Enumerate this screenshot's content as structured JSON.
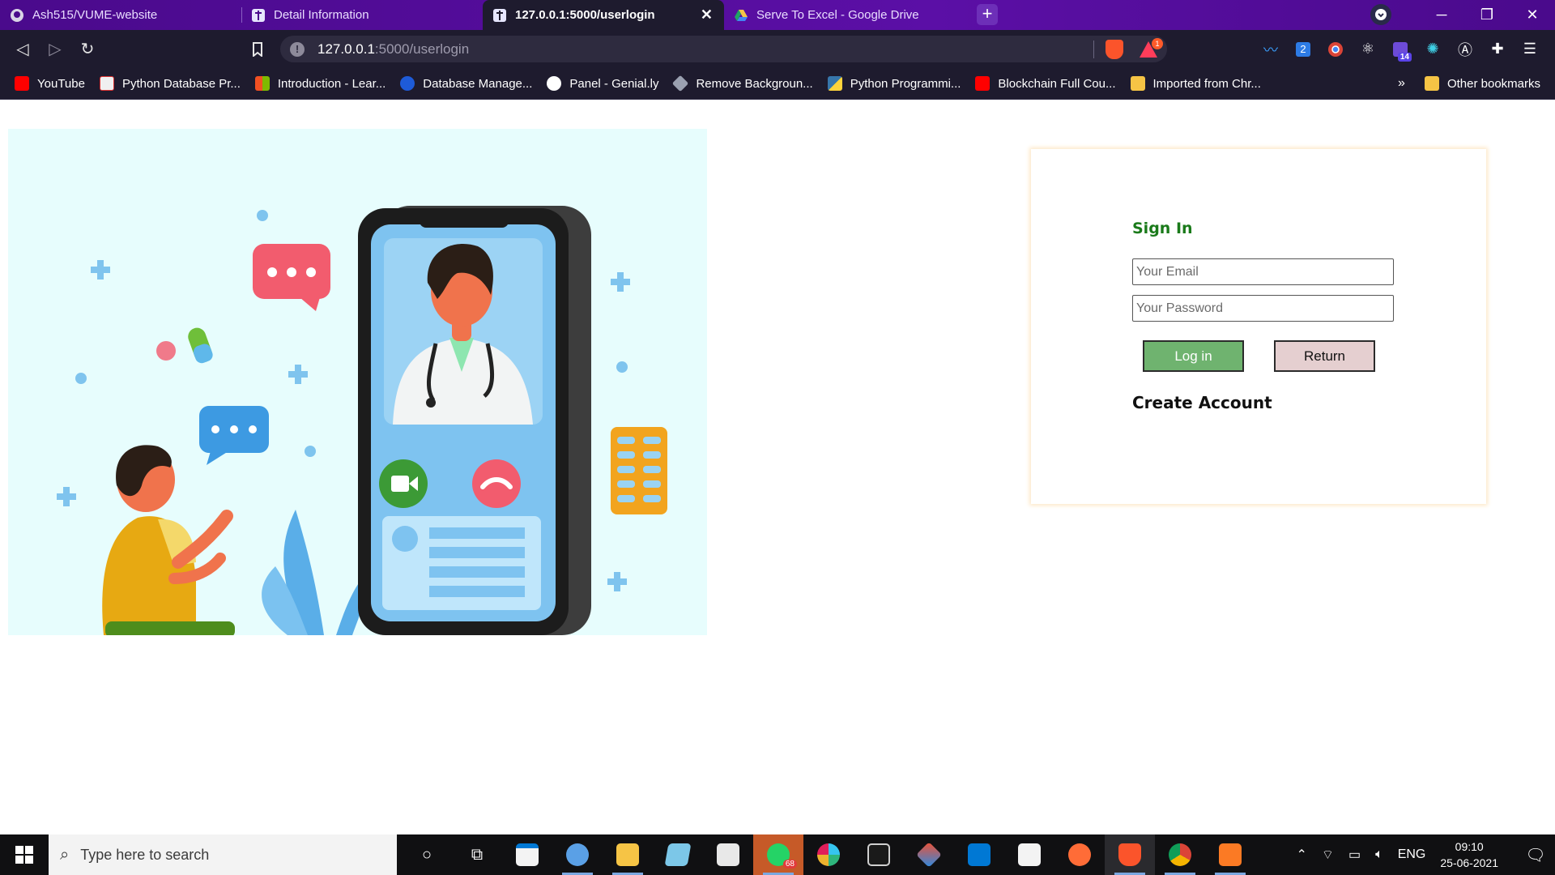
{
  "browser": {
    "tabs": [
      {
        "title": "Ash515/VUME-website",
        "favicon": "github-icon",
        "active": false
      },
      {
        "title": "Detail Information",
        "favicon": "caduceus-icon",
        "active": false
      },
      {
        "title": "127.0.0.1:5000/userlogin",
        "favicon": "caduceus-icon",
        "active": true
      },
      {
        "title": "Serve To Excel - Google Drive",
        "favicon": "google-drive-icon",
        "active": false
      }
    ],
    "new_tab_label": "+",
    "url": {
      "host": "127.0.0.1",
      "path": ":5000/userlogin"
    },
    "rewards_count": "1",
    "extension_badges": {
      "ext2": "2",
      "ext6": "14"
    },
    "bookmarks": [
      {
        "label": "YouTube",
        "icon": "youtube-icon",
        "color": "#ff0000"
      },
      {
        "label": "Python Database Pr...",
        "icon": "yn-icon",
        "color": "#f0f0f0"
      },
      {
        "label": "Introduction - Lear...",
        "icon": "microsoft-icon",
        "color": "#f25022"
      },
      {
        "label": "Database Manage...",
        "icon": "c-icon",
        "color": "#1e5bd8"
      },
      {
        "label": "Panel - Genial.ly",
        "icon": "genially-icon",
        "color": "#ffffff"
      },
      {
        "label": "Remove Backgroun...",
        "icon": "layers-icon",
        "color": "#9aa0b0"
      },
      {
        "label": "Python Programmi...",
        "icon": "python-icon",
        "color": "#3776ab"
      },
      {
        "label": "Blockchain Full Cou...",
        "icon": "youtube-icon",
        "color": "#ff0000"
      },
      {
        "label": "Imported from Chr...",
        "icon": "folder-icon",
        "color": "#f6c445"
      }
    ],
    "bookmarks_more": "»",
    "other_bookmarks": "Other bookmarks"
  },
  "login": {
    "title": "Sign In",
    "email_placeholder": "Your Email",
    "password_placeholder": "Your Password",
    "login_label": "Log in",
    "return_label": "Return",
    "create_account_label": "Create Account"
  },
  "taskbar": {
    "search_placeholder": "Type here to search",
    "whatsapp_badge": "68",
    "language": "ENG",
    "time": "09:10",
    "date": "25-06-2021"
  },
  "colors": {
    "browser_chrome": "#1e1b2e",
    "tabstrip": "#5b0fa6",
    "hero_bg": "#e7fdfd",
    "signin_title": "#1a7a1a",
    "login_button": "#6fb36f",
    "return_button": "#e5cfd0"
  }
}
